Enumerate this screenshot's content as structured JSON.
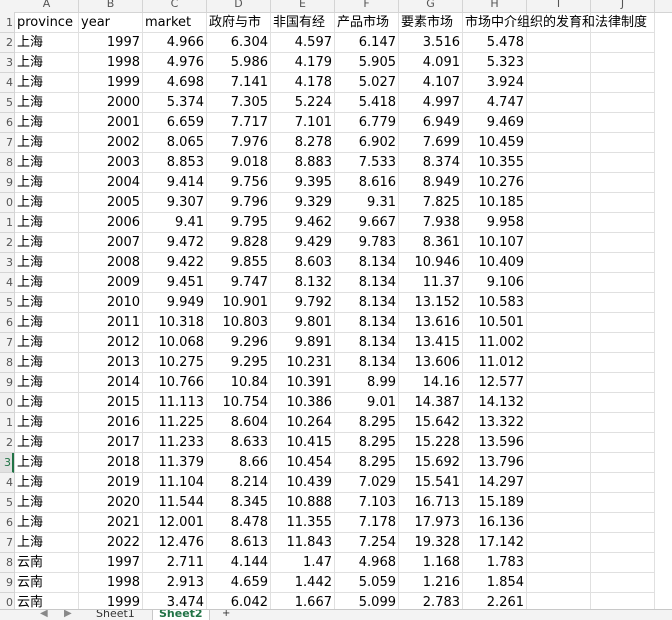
{
  "sheet": {
    "column_letters": [
      "A",
      "B",
      "C",
      "D",
      "E",
      "F",
      "G",
      "H",
      "I",
      "J"
    ],
    "row_numbers": [
      "1",
      "2",
      "3",
      "4",
      "5",
      "6",
      "7",
      "8",
      "9",
      "0",
      "1",
      "2",
      "3",
      "4",
      "5",
      "6",
      "7",
      "8",
      "9",
      "0",
      "1",
      "2",
      "3",
      "4",
      "5",
      "6",
      "7",
      "8",
      "9",
      "0"
    ],
    "active_row_index": 22,
    "headers": [
      "province",
      "year",
      "market",
      "政府与市",
      "非国有经",
      "产品市场",
      "要素市场",
      "市场中介组织的发育和法律制度"
    ],
    "rows": [
      [
        "上海",
        "1997",
        "4.966",
        "6.304",
        "4.597",
        "6.147",
        "3.516",
        "5.478"
      ],
      [
        "上海",
        "1998",
        "4.976",
        "5.986",
        "4.179",
        "5.905",
        "4.091",
        "5.323"
      ],
      [
        "上海",
        "1999",
        "4.698",
        "7.141",
        "4.178",
        "5.027",
        "4.107",
        "3.924"
      ],
      [
        "上海",
        "2000",
        "5.374",
        "7.305",
        "5.224",
        "5.418",
        "4.997",
        "4.747"
      ],
      [
        "上海",
        "2001",
        "6.659",
        "7.717",
        "7.101",
        "6.779",
        "6.949",
        "9.469"
      ],
      [
        "上海",
        "2002",
        "8.065",
        "7.976",
        "8.278",
        "6.902",
        "7.699",
        "10.459"
      ],
      [
        "上海",
        "2003",
        "8.853",
        "9.018",
        "8.883",
        "7.533",
        "8.374",
        "10.355"
      ],
      [
        "上海",
        "2004",
        "9.414",
        "9.756",
        "9.395",
        "8.616",
        "8.949",
        "10.276"
      ],
      [
        "上海",
        "2005",
        "9.307",
        "9.796",
        "9.329",
        "9.31",
        "7.825",
        "10.185"
      ],
      [
        "上海",
        "2006",
        "9.41",
        "9.795",
        "9.462",
        "9.667",
        "7.938",
        "9.958"
      ],
      [
        "上海",
        "2007",
        "9.472",
        "9.828",
        "9.429",
        "9.783",
        "8.361",
        "10.107"
      ],
      [
        "上海",
        "2008",
        "9.422",
        "9.855",
        "8.603",
        "8.134",
        "10.946",
        "10.409"
      ],
      [
        "上海",
        "2009",
        "9.451",
        "9.747",
        "8.132",
        "8.134",
        "11.37",
        "9.106"
      ],
      [
        "上海",
        "2010",
        "9.949",
        "10.901",
        "9.792",
        "8.134",
        "13.152",
        "10.583"
      ],
      [
        "上海",
        "2011",
        "10.318",
        "10.803",
        "9.801",
        "8.134",
        "13.616",
        "10.501"
      ],
      [
        "上海",
        "2012",
        "10.068",
        "9.296",
        "9.891",
        "8.134",
        "13.415",
        "11.002"
      ],
      [
        "上海",
        "2013",
        "10.275",
        "9.295",
        "10.231",
        "8.134",
        "13.606",
        "11.012"
      ],
      [
        "上海",
        "2014",
        "10.766",
        "10.84",
        "10.391",
        "8.99",
        "14.16",
        "12.577"
      ],
      [
        "上海",
        "2015",
        "11.113",
        "10.754",
        "10.386",
        "9.01",
        "14.387",
        "14.132"
      ],
      [
        "上海",
        "2016",
        "11.225",
        "8.604",
        "10.264",
        "8.295",
        "15.642",
        "13.322"
      ],
      [
        "上海",
        "2017",
        "11.233",
        "8.633",
        "10.415",
        "8.295",
        "15.228",
        "13.596"
      ],
      [
        "上海",
        "2018",
        "11.379",
        "8.66",
        "10.454",
        "8.295",
        "15.692",
        "13.796"
      ],
      [
        "上海",
        "2019",
        "11.104",
        "8.214",
        "10.439",
        "7.029",
        "15.541",
        "14.297"
      ],
      [
        "上海",
        "2020",
        "11.544",
        "8.345",
        "10.888",
        "7.103",
        "16.713",
        "15.189"
      ],
      [
        "上海",
        "2021",
        "12.001",
        "8.478",
        "11.355",
        "7.178",
        "17.973",
        "16.136"
      ],
      [
        "上海",
        "2022",
        "12.476",
        "8.613",
        "11.843",
        "7.254",
        "19.328",
        "17.142"
      ],
      [
        "云南",
        "1997",
        "2.711",
        "4.144",
        "1.47",
        "4.968",
        "1.168",
        "1.783"
      ],
      [
        "云南",
        "1998",
        "2.913",
        "4.659",
        "1.442",
        "5.059",
        "1.216",
        "1.854"
      ],
      [
        "云南",
        "1999",
        "3.474",
        "6.042",
        "1.667",
        "5.099",
        "2.783",
        "2.261"
      ]
    ]
  },
  "tabs": {
    "nav": [
      "◀",
      "▶"
    ],
    "items": [
      "Sheet1",
      "Sheet2"
    ],
    "active": 1,
    "add_label": "+"
  }
}
